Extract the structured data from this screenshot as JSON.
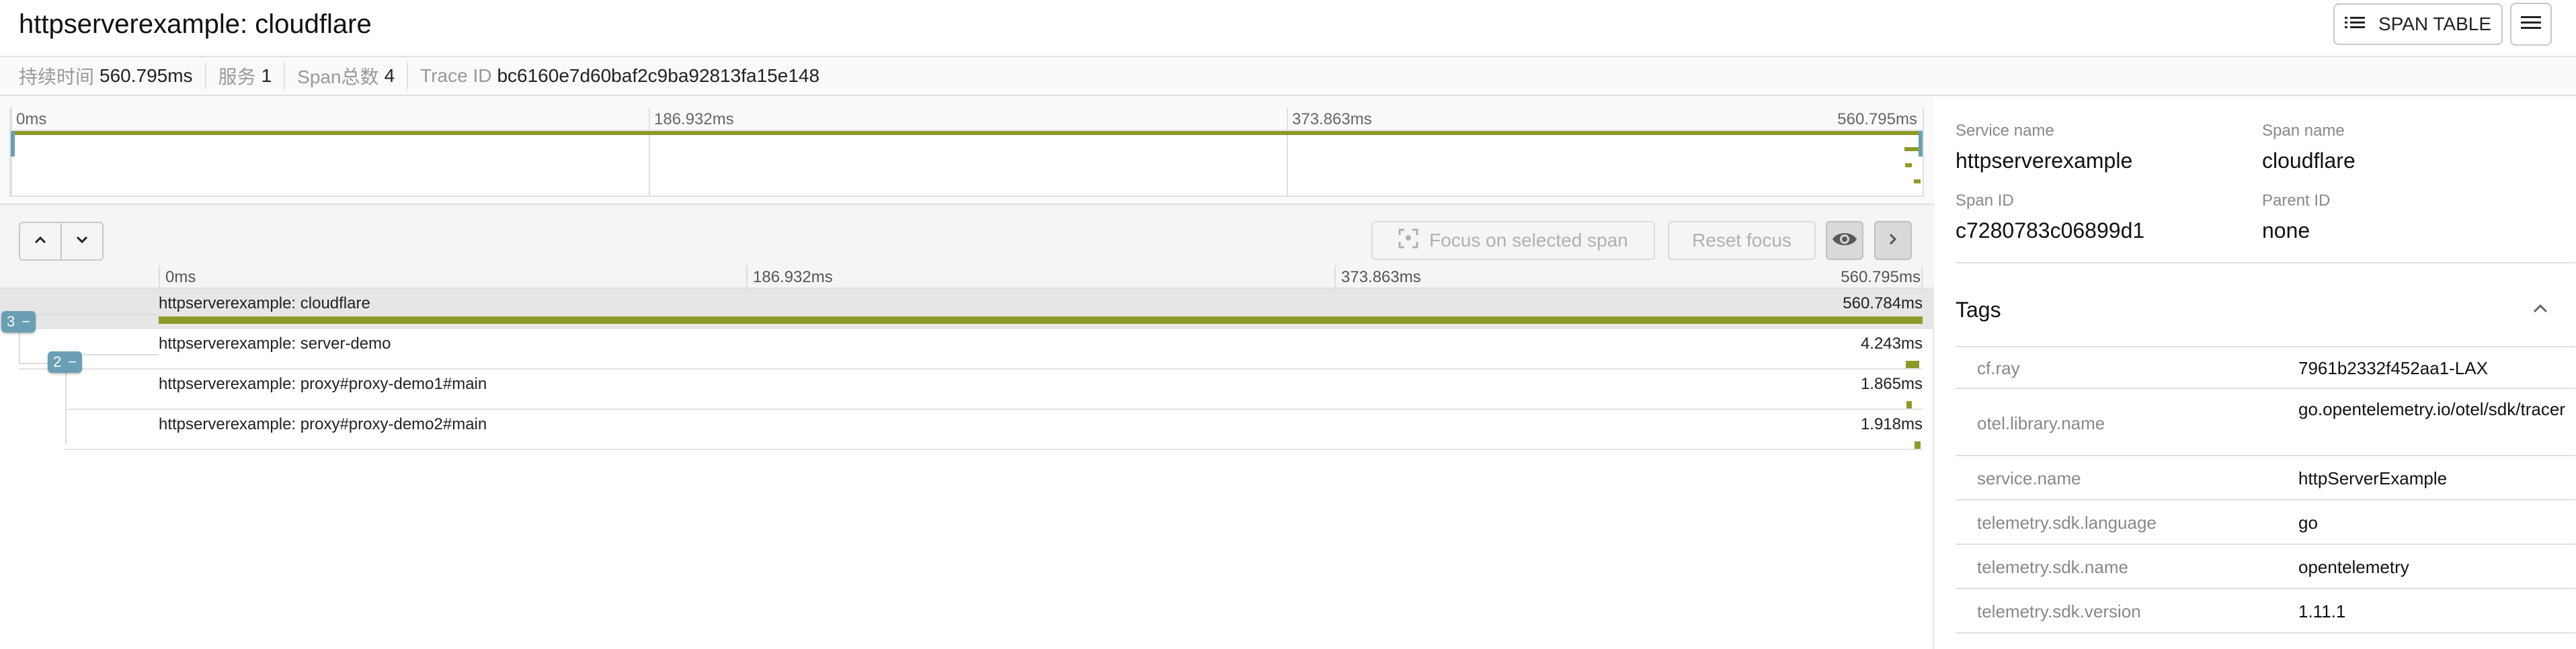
{
  "header": {
    "title": "httpserverexample: cloudflare",
    "span_table_label": "SPAN TABLE",
    "span_table_icon": "list-icon",
    "menu_icon": "hamburger-menu-icon"
  },
  "stats": [
    {
      "label": "持续时间",
      "value": "560.795ms"
    },
    {
      "label": "服务",
      "value": "1"
    },
    {
      "label": "Span总数",
      "value": "4"
    },
    {
      "label": "Trace ID",
      "value": "bc6160e7d60baf2c9ba92813fa15e148"
    }
  ],
  "minimap": {
    "ticks": [
      "0ms",
      "186.932ms",
      "373.863ms",
      "560.795ms"
    ]
  },
  "toolbar": {
    "prev_icon": "chevron-up-icon",
    "next_icon": "chevron-down-icon",
    "focus_label": "Focus on selected span",
    "focus_icon": "focus-frame-icon",
    "reset_label": "Reset focus",
    "eye_icon": "eye-icon",
    "expand_icon": "chevron-right-icon"
  },
  "ruler": {
    "ticks": [
      "0ms",
      "186.932ms",
      "373.863ms",
      "560.795ms"
    ]
  },
  "trace": {
    "total_ms": 560.795,
    "spans": [
      {
        "name": "httpserverexample: cloudflare",
        "duration": "560.784ms",
        "start_ms": 0,
        "duration_ms": 560.784,
        "depth": 0,
        "children": 3,
        "selected": true
      },
      {
        "name": "httpserverexample: server-demo",
        "duration": "4.243ms",
        "start_ms": 555.5,
        "duration_ms": 4.243,
        "depth": 1,
        "children": 2,
        "selected": false
      },
      {
        "name": "httpserverexample: proxy#proxy-demo1#main",
        "duration": "1.865ms",
        "start_ms": 555.6,
        "duration_ms": 1.865,
        "depth": 2,
        "children": 0,
        "selected": false
      },
      {
        "name": "httpserverexample: proxy#proxy-demo2#main",
        "duration": "1.918ms",
        "start_ms": 558.3,
        "duration_ms": 1.918,
        "depth": 2,
        "children": 0,
        "selected": false
      }
    ],
    "badges": [
      {
        "count": "3",
        "symbol": "−"
      },
      {
        "count": "2",
        "symbol": "−"
      }
    ]
  },
  "detail": {
    "fields": [
      {
        "label": "Service name",
        "value": "httpserverexample"
      },
      {
        "label": "Span name",
        "value": "cloudflare"
      },
      {
        "label": "Span ID",
        "value": "c7280783c06899d1"
      },
      {
        "label": "Parent ID",
        "value": "none"
      }
    ],
    "tags_title": "Tags",
    "tags_toggle_icon": "chevron-up-icon",
    "tags": [
      {
        "key": "cf.ray",
        "value": "7961b2332f452aa1-LAX"
      },
      {
        "key": "otel.library.name",
        "value": "go.opentelemetry.io/otel/sdk/tracer"
      },
      {
        "key": "service.name",
        "value": "httpServerExample"
      },
      {
        "key": "telemetry.sdk.language",
        "value": "go"
      },
      {
        "key": "telemetry.sdk.name",
        "value": "opentelemetry"
      },
      {
        "key": "telemetry.sdk.version",
        "value": "1.11.1"
      }
    ]
  },
  "colors": {
    "span_bar": "#8e9a28",
    "badge": "#6a9fb5",
    "selected_row": "#e6e6e6"
  }
}
